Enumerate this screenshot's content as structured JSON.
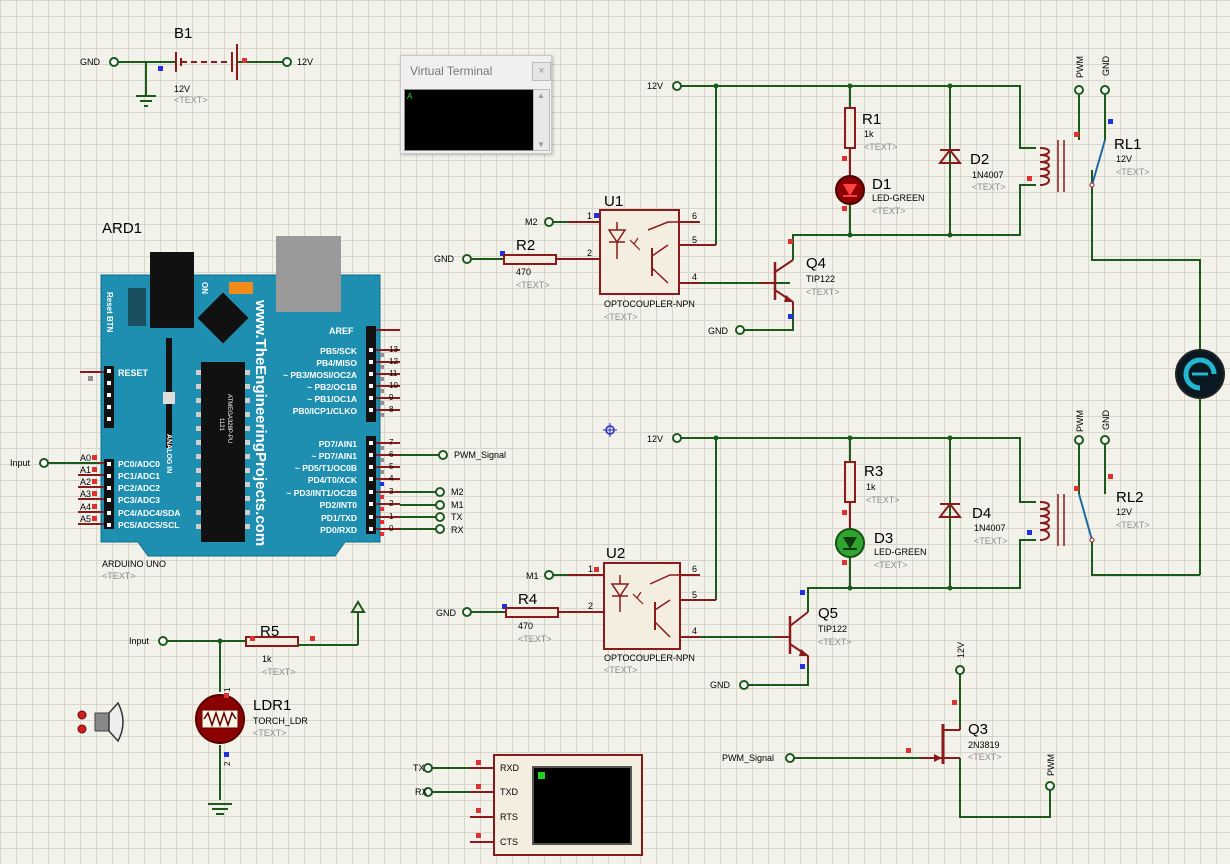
{
  "battery": {
    "ref": "B1",
    "value": "12V",
    "text": "<TEXT>",
    "gnd": "GND",
    "vcc": "12V"
  },
  "virtual_terminal": {
    "title": "Virtual Terminal",
    "close": "×",
    "cursor": "A"
  },
  "arduino": {
    "ref": "ARD1",
    "model": "ARDUINO UNO",
    "text": "<TEXT>",
    "website": "www.TheEngineeringProjects.com",
    "reset_btn": "Reset BTN",
    "on": "ON",
    "analog_in": "ANALOG IN",
    "chip_a": "1121",
    "chip_b": "ATMEGA328P-PU",
    "reset": "RESET",
    "aref": "AREF",
    "digital_high": [
      "PB5/SCK",
      "PB4/MISO",
      "~ PB3/MOSI/OC2A",
      "~ PB2/OC1B",
      "~ PB1/OC1A",
      "PB0/ICP1/CLKO"
    ],
    "digital_high_nums": [
      "13",
      "12",
      "11",
      "10",
      "9",
      "8"
    ],
    "digital_low": [
      "PD7/AIN1",
      "~ PD7/AIN1",
      "~ PD5/T1/OC0B",
      "PD4/T0/XCK",
      "~ PD3/INT1/OC2B",
      "PD2/INT0",
      "PD1/TXD",
      "PD0/RXD"
    ],
    "digital_low_nums": [
      "7",
      "6",
      "5",
      "4",
      "3",
      "2",
      "1",
      "0"
    ],
    "analog": [
      "PC0/ADC0",
      "PC1/ADC1",
      "PC2/ADC2",
      "PC3/ADC3",
      "PC4/ADC4/SDA",
      "PC5/ADC5/SCL"
    ],
    "analog_pins": [
      "A0",
      "A1",
      "A2",
      "A3",
      "A4",
      "A5"
    ]
  },
  "nets": {
    "input": "Input",
    "pwm": "PWM_Signal",
    "m2": "M2",
    "m1": "M1",
    "tx": "TX",
    "rx": "RX",
    "gnd": "GND",
    "v12": "12V",
    "pwm_short": "PWM"
  },
  "u1": {
    "ref": "U1",
    "model": "OPTOCOUPLER-NPN",
    "text": "<TEXT>",
    "pins": [
      "1",
      "2",
      "4",
      "5",
      "6"
    ]
  },
  "u2": {
    "ref": "U2",
    "model": "OPTOCOUPLER-NPN",
    "text": "<TEXT>",
    "pins": [
      "1",
      "2",
      "4",
      "5",
      "6"
    ]
  },
  "r1": {
    "ref": "R1",
    "value": "1k",
    "text": "<TEXT>"
  },
  "r2": {
    "ref": "R2",
    "value": "470",
    "text": "<TEXT>"
  },
  "r3": {
    "ref": "R3",
    "value": "1k",
    "text": "<TEXT>"
  },
  "r4": {
    "ref": "R4",
    "value": "470",
    "text": "<TEXT>"
  },
  "r5": {
    "ref": "R5",
    "value": "1k",
    "text": "<TEXT>"
  },
  "d1": {
    "ref": "D1",
    "value": "LED-GREEN",
    "text": "<TEXT>"
  },
  "d2": {
    "ref": "D2",
    "value": "1N4007",
    "text": "<TEXT>"
  },
  "d3": {
    "ref": "D3",
    "value": "LED-GREEN",
    "text": "<TEXT>"
  },
  "d4": {
    "ref": "D4",
    "value": "1N4007",
    "text": "<TEXT>"
  },
  "q4": {
    "ref": "Q4",
    "value": "TIP122",
    "text": "<TEXT>"
  },
  "q5": {
    "ref": "Q5",
    "value": "TIP122",
    "text": "<TEXT>"
  },
  "q3": {
    "ref": "Q3",
    "value": "2N3819",
    "text": "<TEXT>"
  },
  "rl1": {
    "ref": "RL1",
    "value": "12V",
    "text": "<TEXT>"
  },
  "rl2": {
    "ref": "RL2",
    "value": "12V",
    "text": "<TEXT>"
  },
  "ldr1": {
    "ref": "LDR1",
    "value": "TORCH_LDR",
    "text": "<TEXT>",
    "pin1": "1",
    "pin2": "2"
  },
  "serial": {
    "pins": [
      "RXD",
      "TXD",
      "RTS",
      "CTS"
    ]
  },
  "colors": {
    "wire": "#1b5a1b",
    "component": "#8b1a1a",
    "body": "#f3eee0",
    "board": "#1e8fb0",
    "led_on": "#2fa52f",
    "led_off": "#8b0000"
  }
}
